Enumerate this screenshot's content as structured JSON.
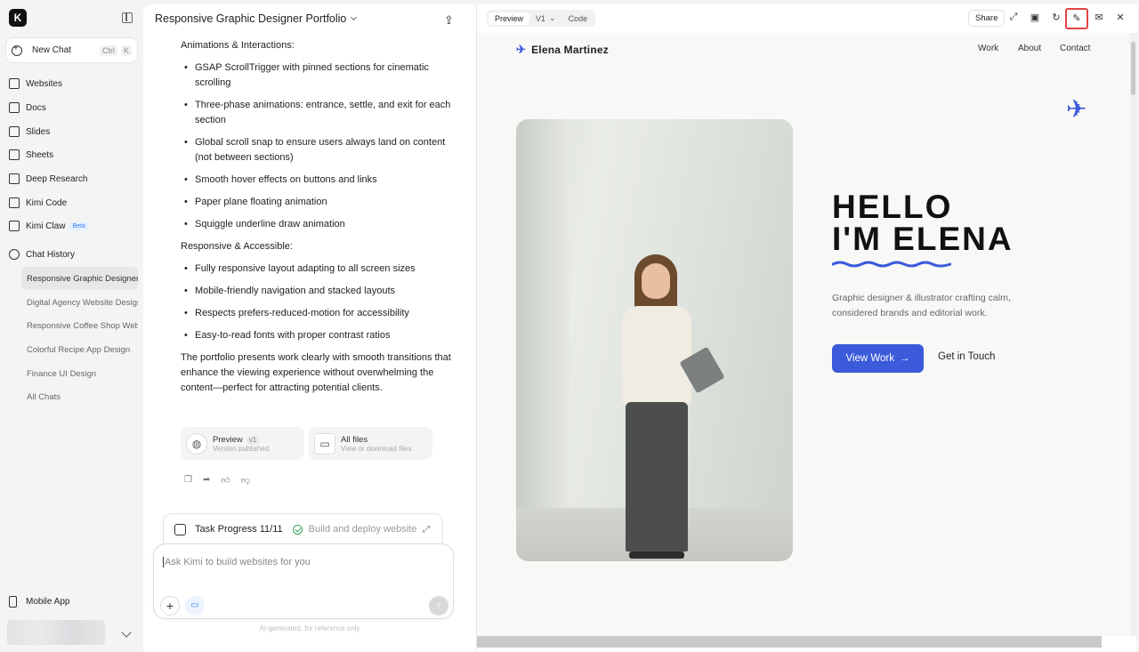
{
  "sidebar": {
    "logo": "K",
    "new_chat": "New Chat",
    "shortcut": [
      "Ctrl",
      "K"
    ],
    "items": [
      {
        "label": "Websites",
        "icon": "monitor-icon"
      },
      {
        "label": "Docs",
        "icon": "doc-icon"
      },
      {
        "label": "Slides",
        "icon": "slides-icon"
      },
      {
        "label": "Sheets",
        "icon": "sheet-icon"
      },
      {
        "label": "Deep Research",
        "icon": "research-icon"
      },
      {
        "label": "Kimi Code",
        "icon": "code-icon"
      },
      {
        "label": "Kimi Claw",
        "icon": "claw-icon",
        "badge": "Beta"
      }
    ],
    "history_title": "Chat History",
    "history": [
      "Responsive Graphic Designer Portfolio",
      "Digital Agency Website Design",
      "Responsive Coffee Shop Website",
      "Colorful Recipe App Design",
      "Finance UI Design",
      "All Chats"
    ],
    "mobile_app": "Mobile App"
  },
  "chat": {
    "title": "Responsive Graphic Designer Portfolio",
    "section1_title": "Animations & Interactions:",
    "section1_items": [
      "GSAP ScrollTrigger with pinned sections for cinematic scrolling",
      "Three-phase animations: entrance, settle, and exit for each section",
      "Global scroll snap to ensure users always land on content (not between sections)",
      "Smooth hover effects on buttons and links",
      "Paper plane floating animation",
      "Squiggle underline draw animation"
    ],
    "section2_title": "Responsive & Accessible:",
    "section2_items": [
      "Fully responsive layout adapting to all screen sizes",
      "Mobile-friendly navigation and stacked layouts",
      "Respects prefers-reduced-motion for accessibility",
      "Easy-to-read fonts with proper contrast ratios"
    ],
    "summary": "The portfolio presents work clearly with smooth transitions that enhance the viewing experience without overwhelming the content—perfect for attracting potential clients.",
    "card_preview": {
      "title": "Preview",
      "tag": "v1",
      "sub": "Version published"
    },
    "card_files": {
      "title": "All files",
      "sub": "View or download files"
    },
    "task": {
      "label": "Task Progress 11/11",
      "status": "Build and deploy website"
    },
    "composer_placeholder": "Ask Kimi to build websites for you",
    "disclaimer": "AI-generated, for reference only"
  },
  "preview": {
    "tabs": [
      "Preview",
      "V1",
      "Code"
    ],
    "share": "Share",
    "site": {
      "brand": "Elena Martinez",
      "nav": [
        "Work",
        "About",
        "Contact"
      ],
      "hello_line1": "HELLO",
      "hello_line2": "I'M ELENA",
      "tagline": "Graphic designer & illustrator crafting calm, considered brands and editorial work.",
      "cta_primary": "View Work",
      "cta_secondary": "Get in Touch"
    },
    "accent": "#3b5bdb"
  }
}
